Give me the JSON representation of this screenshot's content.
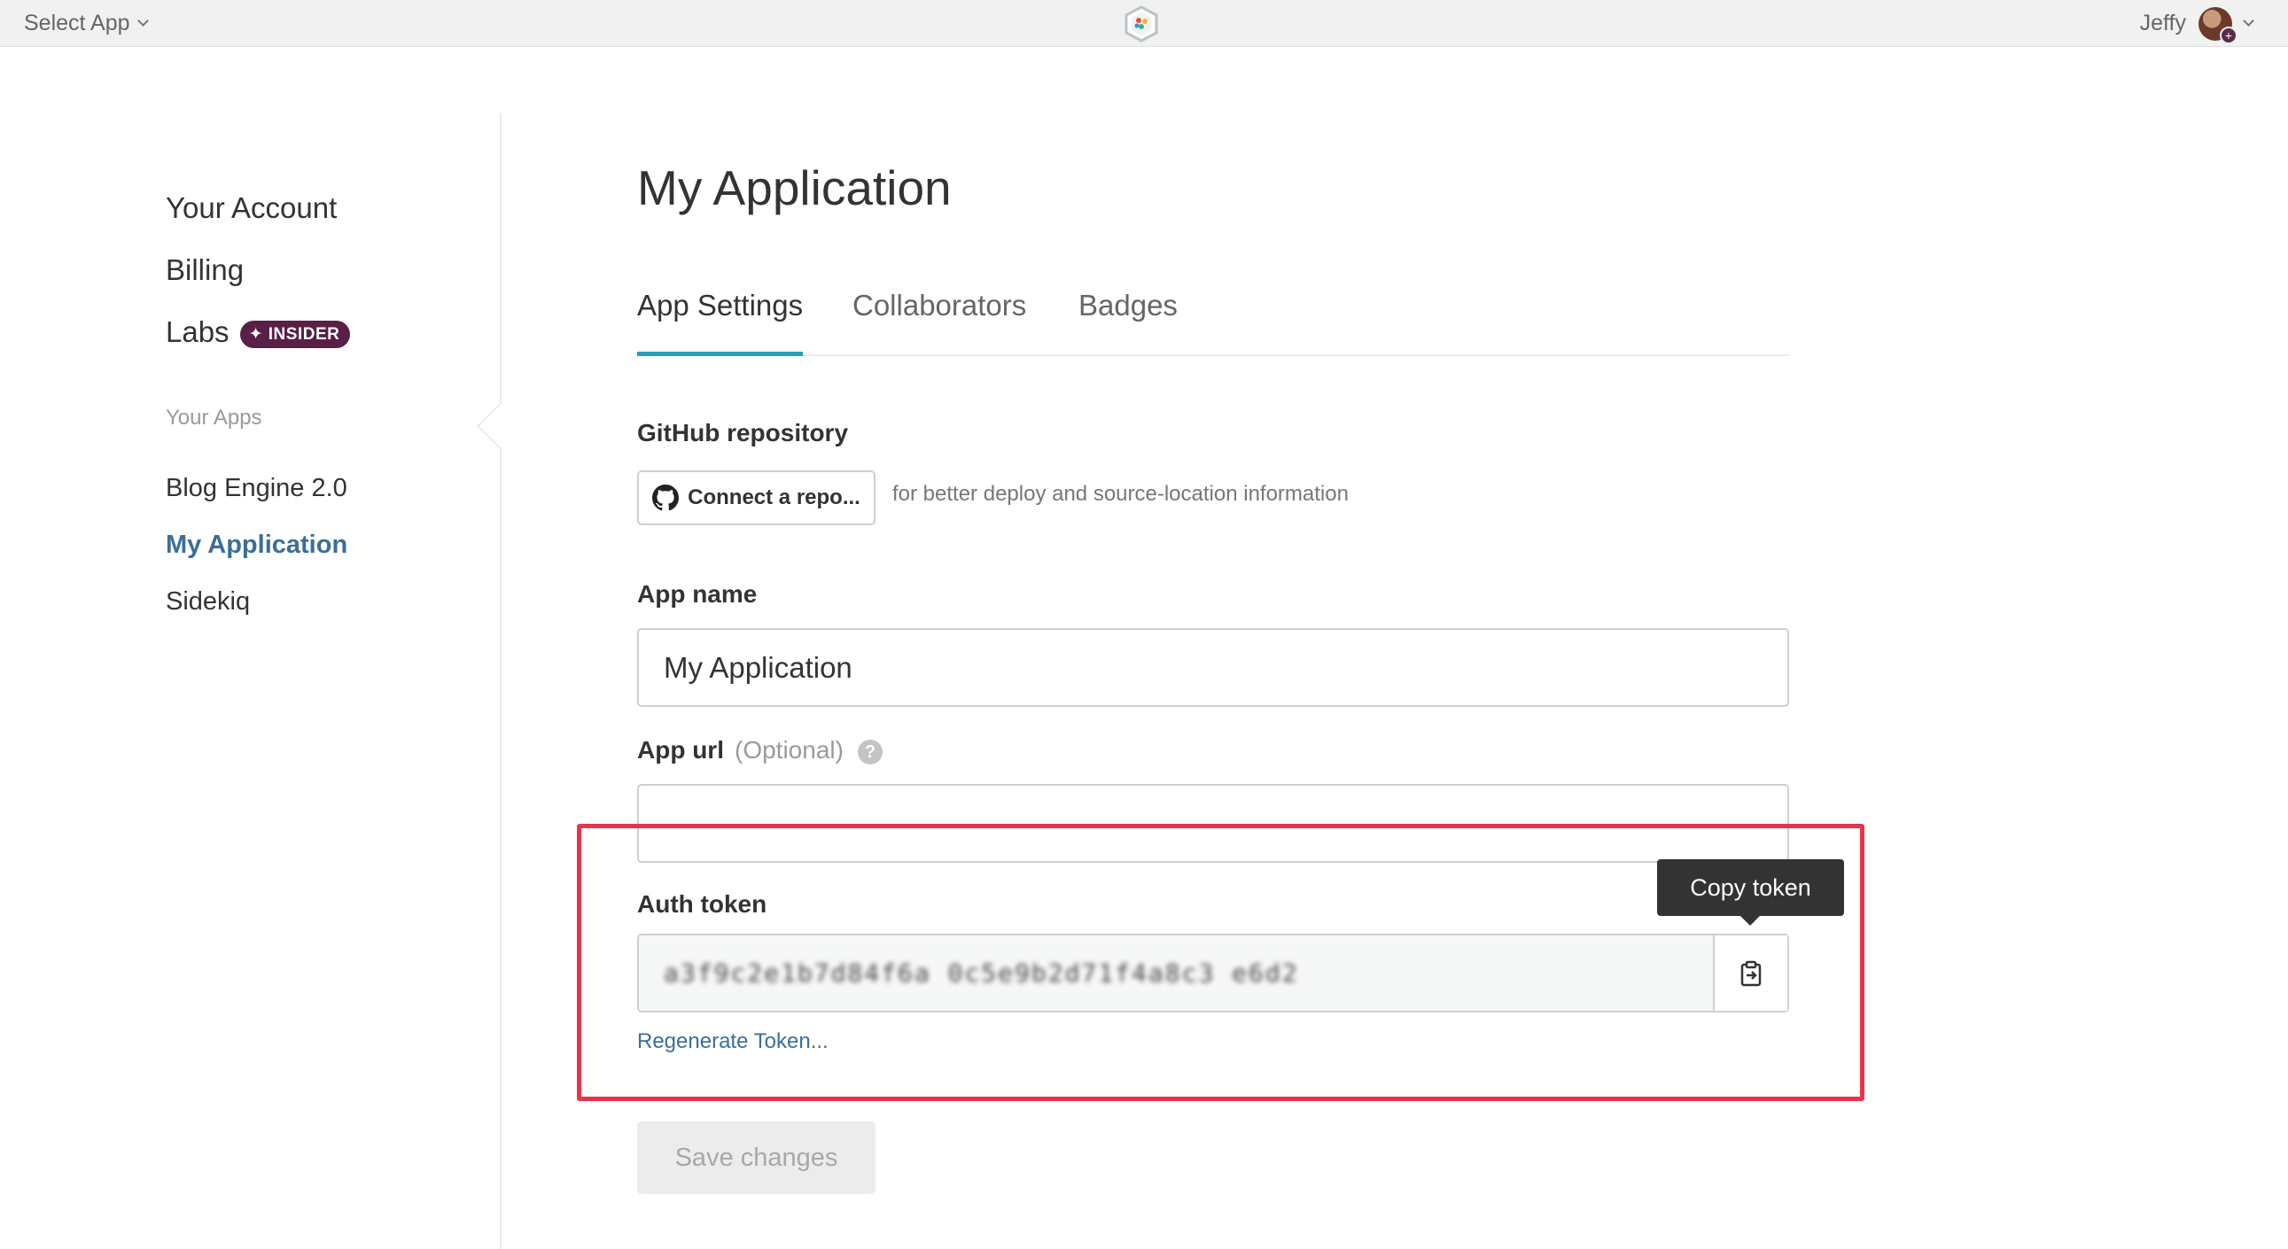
{
  "topbar": {
    "app_select_label": "Select App",
    "user_name": "Jeffy"
  },
  "sidebar": {
    "account_links": [
      {
        "label": "Your Account"
      },
      {
        "label": "Billing"
      },
      {
        "label": "Labs",
        "badge": "INSIDER"
      }
    ],
    "apps_section_label": "Your Apps",
    "apps": [
      {
        "label": "Blog Engine 2.0",
        "active": false
      },
      {
        "label": "My Application",
        "active": true
      },
      {
        "label": "Sidekiq",
        "active": false
      }
    ]
  },
  "main": {
    "title": "My Application",
    "tabs": [
      {
        "label": "App Settings",
        "active": true
      },
      {
        "label": "Collaborators",
        "active": false
      },
      {
        "label": "Badges",
        "active": false
      }
    ],
    "github": {
      "label": "GitHub repository",
      "button_label": "Connect a repo...",
      "hint": "for better deploy and source-location information"
    },
    "app_name": {
      "label": "App name",
      "value": "My Application"
    },
    "app_url": {
      "label": "App url",
      "optional_text": "(Optional)",
      "help_glyph": "?",
      "value": ""
    },
    "auth_token": {
      "label": "Auth token",
      "value": "a3f9c2e1b7d84f6a 0c5e9b2d71f4a8c3 e6d2",
      "tooltip": "Copy token",
      "regenerate_label": "Regenerate Token..."
    },
    "save_label": "Save changes"
  },
  "colors": {
    "accent_tab": "#25a1b5",
    "link": "#3b6e99",
    "highlight": "#e8344b",
    "insider_badge": "#5a1f47"
  }
}
